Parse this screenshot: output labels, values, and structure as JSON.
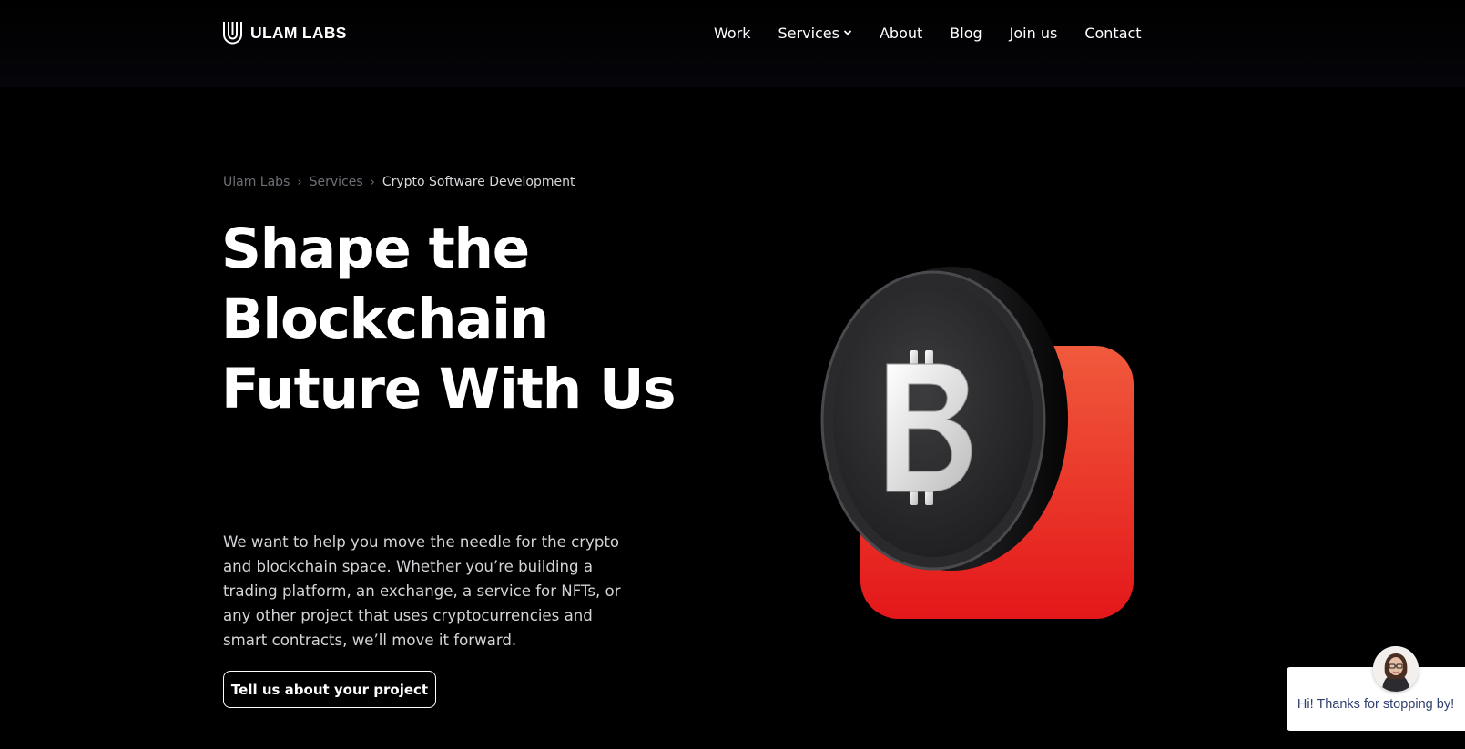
{
  "header": {
    "brand": "ULAM LABS",
    "logo_icon": "ulam-u-logo-icon",
    "nav": [
      {
        "label": "Work"
      },
      {
        "label": "Services",
        "has_dropdown": true
      },
      {
        "label": "About"
      },
      {
        "label": "Blog"
      },
      {
        "label": "Join us"
      },
      {
        "label": "Contact"
      }
    ]
  },
  "breadcrumb": {
    "items": [
      "Ulam Labs",
      "Services"
    ],
    "current": "Crypto Software Development",
    "separator": "›"
  },
  "hero": {
    "headline": "Shape the Blockchain Future With Us",
    "description": "We want to help you move the needle for the crypto and blockchain space. Whether you’re building a trading platform, an exchange, a service for NFTs, or any other project that uses cryptocurrencies and smart contracts, we’ll move it forward.",
    "cta_label": "Tell us about your project",
    "illustration": "bitcoin-coin-icon",
    "accent_color": "#e8281e"
  },
  "chat_widget": {
    "message": "Hi! Thanks for stopping by!",
    "avatar": "support-agent-avatar"
  },
  "colors": {
    "background": "#000000",
    "text": "#ffffff",
    "muted": "#6f6f78",
    "chat_text": "#2f3f70"
  }
}
